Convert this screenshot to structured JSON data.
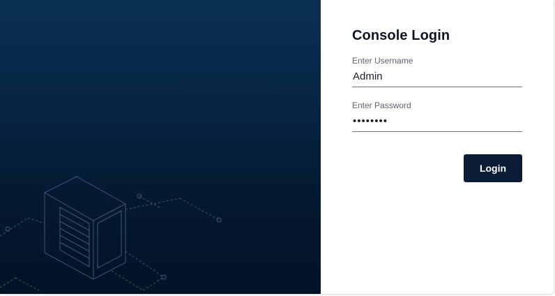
{
  "login": {
    "title": "Console Login",
    "username": {
      "label": "Enter Username",
      "value": "Admin"
    },
    "password": {
      "label": "Enter Password",
      "value": "••••••••"
    },
    "submit_label": "Login"
  },
  "colors": {
    "hero_top": "#0b3152",
    "hero_bottom": "#031327",
    "button_bg": "#0c1c36",
    "title_text": "#0b1526",
    "illustration_line": "#3e5777"
  },
  "icons": {
    "illustration": "server-rack-illustration"
  }
}
